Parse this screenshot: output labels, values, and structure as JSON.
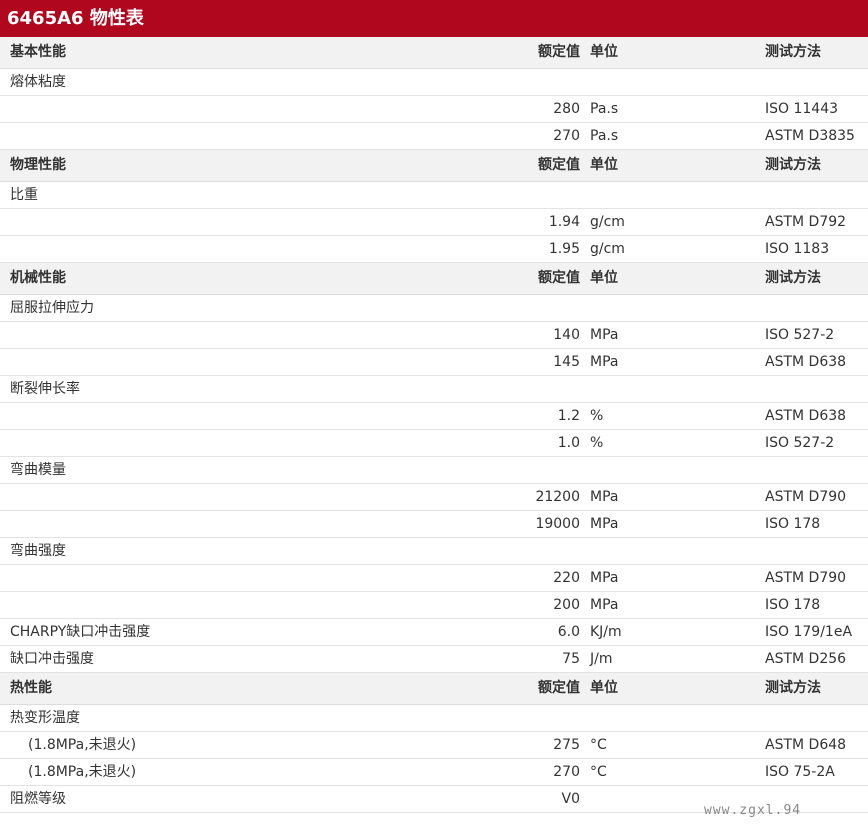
{
  "title": "6465A6 物性表",
  "header_labels": {
    "value": "额定值",
    "unit": "单位",
    "method": "测试方法"
  },
  "rows": [
    {
      "type": "section",
      "name": "基本性能"
    },
    {
      "type": "item",
      "name": "熔体粘度"
    },
    {
      "type": "data",
      "value": "280",
      "unit": "Pa.s",
      "method": "ISO 11443"
    },
    {
      "type": "data",
      "value": "270",
      "unit": "Pa.s",
      "method": "ASTM D3835"
    },
    {
      "type": "section",
      "name": "物理性能"
    },
    {
      "type": "item",
      "name": "比重"
    },
    {
      "type": "data",
      "value": "1.94",
      "unit": "g/cm",
      "method": "ASTM D792"
    },
    {
      "type": "data",
      "value": "1.95",
      "unit": "g/cm",
      "method": "ISO 1183"
    },
    {
      "type": "section",
      "name": "机械性能"
    },
    {
      "type": "item",
      "name": "屈服拉伸应力"
    },
    {
      "type": "data",
      "value": "140",
      "unit": "MPa",
      "method": "ISO 527-2"
    },
    {
      "type": "data",
      "value": "145",
      "unit": "MPa",
      "method": "ASTM D638"
    },
    {
      "type": "item",
      "name": "断裂伸长率"
    },
    {
      "type": "data",
      "value": "1.2",
      "unit": "%",
      "method": "ASTM D638"
    },
    {
      "type": "data",
      "value": "1.0",
      "unit": "%",
      "method": "ISO 527-2"
    },
    {
      "type": "item",
      "name": "弯曲模量"
    },
    {
      "type": "data",
      "value": "21200",
      "unit": "MPa",
      "method": "ASTM D790"
    },
    {
      "type": "data",
      "value": "19000",
      "unit": "MPa",
      "method": "ISO 178"
    },
    {
      "type": "item",
      "name": "弯曲强度"
    },
    {
      "type": "data",
      "value": "220",
      "unit": "MPa",
      "method": "ASTM D790"
    },
    {
      "type": "data",
      "value": "200",
      "unit": "MPa",
      "method": "ISO 178"
    },
    {
      "type": "data",
      "name": "CHARPY缺口冲击强度",
      "value": "6.0",
      "unit": "KJ/m",
      "method": "ISO 179/1eA"
    },
    {
      "type": "data",
      "name": "缺口冲击强度",
      "value": "75",
      "unit": "J/m",
      "method": "ASTM D256"
    },
    {
      "type": "section",
      "name": "热性能"
    },
    {
      "type": "item",
      "name": "热变形温度"
    },
    {
      "type": "data",
      "name": "(1.8MPa,未退火)",
      "indent": true,
      "value": "275",
      "unit": "°C",
      "method": "ASTM D648"
    },
    {
      "type": "data",
      "name": "(1.8MPa,未退火)",
      "indent": true,
      "value": "270",
      "unit": "°C",
      "method": "ISO 75-2A"
    },
    {
      "type": "data",
      "name": "阻燃等级",
      "value": "V0",
      "unit": "",
      "method": ""
    }
  ],
  "watermark": "www.zgxl.94",
  "colors": {
    "title_bar": "#b0071f",
    "section_bg": "#f2f2f2"
  }
}
